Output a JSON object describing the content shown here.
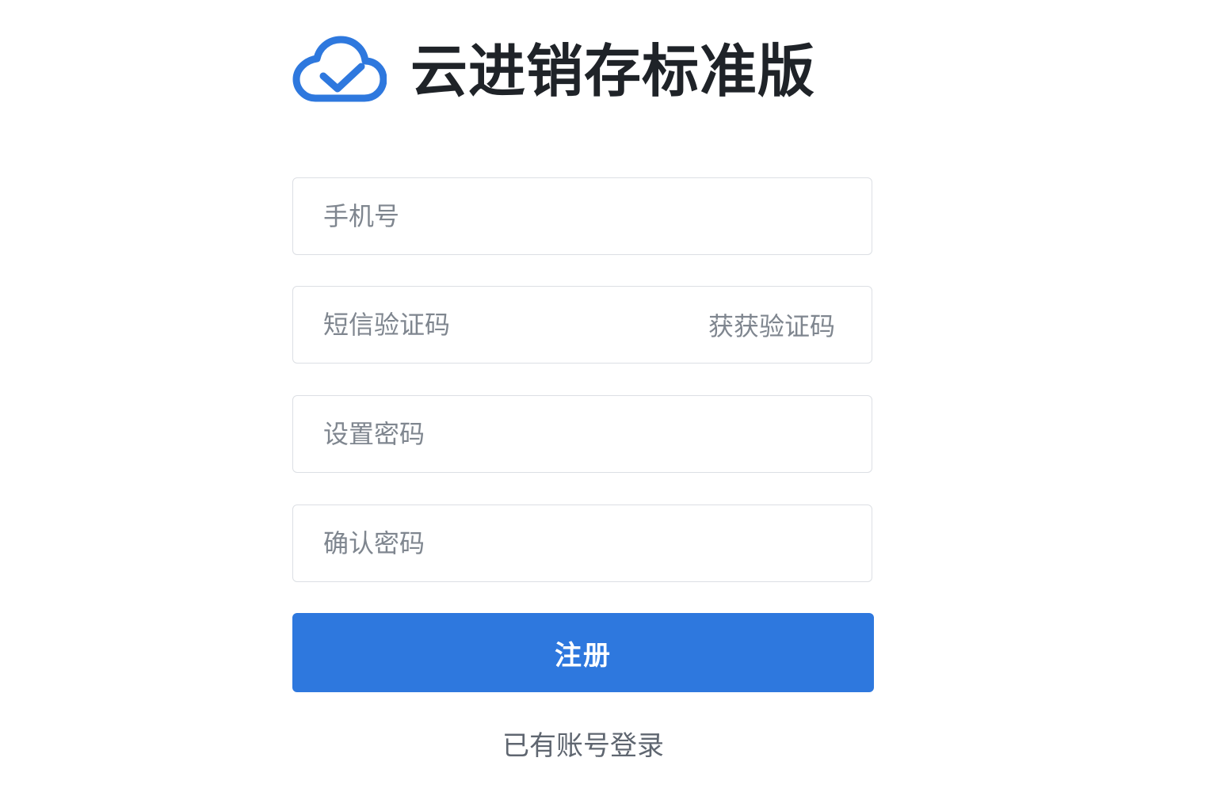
{
  "brand": {
    "logo_icon": "cloud-check-icon",
    "title": "云进销存标准版"
  },
  "form": {
    "phone": {
      "value": "",
      "placeholder": "手机号"
    },
    "sms_code": {
      "value": "",
      "placeholder": "短信验证码",
      "get_code_label": "获获验证码"
    },
    "password": {
      "value": "",
      "placeholder": "设置密码"
    },
    "confirm_password": {
      "value": "",
      "placeholder": "确认密码"
    },
    "submit_label": "注册"
  },
  "footer": {
    "login_link": "已有账号登录"
  },
  "colors": {
    "accent": "#2e78de",
    "title": "#1f2328",
    "placeholder": "#7f868f",
    "border": "#dcdfe4",
    "link": "#5f6670"
  }
}
